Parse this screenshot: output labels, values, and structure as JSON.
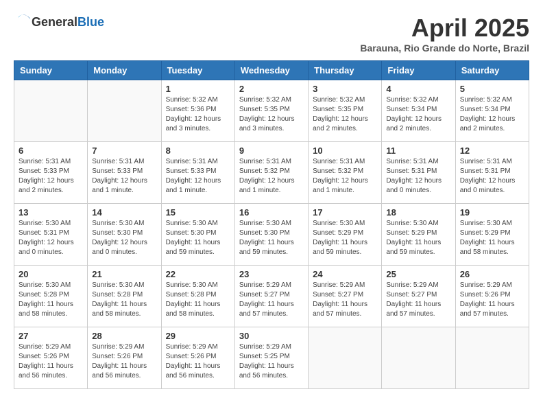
{
  "header": {
    "logo_general": "General",
    "logo_blue": "Blue",
    "month": "April 2025",
    "location": "Barauna, Rio Grande do Norte, Brazil"
  },
  "weekdays": [
    "Sunday",
    "Monday",
    "Tuesday",
    "Wednesday",
    "Thursday",
    "Friday",
    "Saturday"
  ],
  "weeks": [
    [
      {
        "day": "",
        "info": ""
      },
      {
        "day": "",
        "info": ""
      },
      {
        "day": "1",
        "info": "Sunrise: 5:32 AM\nSunset: 5:36 PM\nDaylight: 12 hours and 3 minutes."
      },
      {
        "day": "2",
        "info": "Sunrise: 5:32 AM\nSunset: 5:35 PM\nDaylight: 12 hours and 3 minutes."
      },
      {
        "day": "3",
        "info": "Sunrise: 5:32 AM\nSunset: 5:35 PM\nDaylight: 12 hours and 2 minutes."
      },
      {
        "day": "4",
        "info": "Sunrise: 5:32 AM\nSunset: 5:34 PM\nDaylight: 12 hours and 2 minutes."
      },
      {
        "day": "5",
        "info": "Sunrise: 5:32 AM\nSunset: 5:34 PM\nDaylight: 12 hours and 2 minutes."
      }
    ],
    [
      {
        "day": "6",
        "info": "Sunrise: 5:31 AM\nSunset: 5:33 PM\nDaylight: 12 hours and 2 minutes."
      },
      {
        "day": "7",
        "info": "Sunrise: 5:31 AM\nSunset: 5:33 PM\nDaylight: 12 hours and 1 minute."
      },
      {
        "day": "8",
        "info": "Sunrise: 5:31 AM\nSunset: 5:33 PM\nDaylight: 12 hours and 1 minute."
      },
      {
        "day": "9",
        "info": "Sunrise: 5:31 AM\nSunset: 5:32 PM\nDaylight: 12 hours and 1 minute."
      },
      {
        "day": "10",
        "info": "Sunrise: 5:31 AM\nSunset: 5:32 PM\nDaylight: 12 hours and 1 minute."
      },
      {
        "day": "11",
        "info": "Sunrise: 5:31 AM\nSunset: 5:31 PM\nDaylight: 12 hours and 0 minutes."
      },
      {
        "day": "12",
        "info": "Sunrise: 5:31 AM\nSunset: 5:31 PM\nDaylight: 12 hours and 0 minutes."
      }
    ],
    [
      {
        "day": "13",
        "info": "Sunrise: 5:30 AM\nSunset: 5:31 PM\nDaylight: 12 hours and 0 minutes."
      },
      {
        "day": "14",
        "info": "Sunrise: 5:30 AM\nSunset: 5:30 PM\nDaylight: 12 hours and 0 minutes."
      },
      {
        "day": "15",
        "info": "Sunrise: 5:30 AM\nSunset: 5:30 PM\nDaylight: 11 hours and 59 minutes."
      },
      {
        "day": "16",
        "info": "Sunrise: 5:30 AM\nSunset: 5:30 PM\nDaylight: 11 hours and 59 minutes."
      },
      {
        "day": "17",
        "info": "Sunrise: 5:30 AM\nSunset: 5:29 PM\nDaylight: 11 hours and 59 minutes."
      },
      {
        "day": "18",
        "info": "Sunrise: 5:30 AM\nSunset: 5:29 PM\nDaylight: 11 hours and 59 minutes."
      },
      {
        "day": "19",
        "info": "Sunrise: 5:30 AM\nSunset: 5:29 PM\nDaylight: 11 hours and 58 minutes."
      }
    ],
    [
      {
        "day": "20",
        "info": "Sunrise: 5:30 AM\nSunset: 5:28 PM\nDaylight: 11 hours and 58 minutes."
      },
      {
        "day": "21",
        "info": "Sunrise: 5:30 AM\nSunset: 5:28 PM\nDaylight: 11 hours and 58 minutes."
      },
      {
        "day": "22",
        "info": "Sunrise: 5:30 AM\nSunset: 5:28 PM\nDaylight: 11 hours and 58 minutes."
      },
      {
        "day": "23",
        "info": "Sunrise: 5:29 AM\nSunset: 5:27 PM\nDaylight: 11 hours and 57 minutes."
      },
      {
        "day": "24",
        "info": "Sunrise: 5:29 AM\nSunset: 5:27 PM\nDaylight: 11 hours and 57 minutes."
      },
      {
        "day": "25",
        "info": "Sunrise: 5:29 AM\nSunset: 5:27 PM\nDaylight: 11 hours and 57 minutes."
      },
      {
        "day": "26",
        "info": "Sunrise: 5:29 AM\nSunset: 5:26 PM\nDaylight: 11 hours and 57 minutes."
      }
    ],
    [
      {
        "day": "27",
        "info": "Sunrise: 5:29 AM\nSunset: 5:26 PM\nDaylight: 11 hours and 56 minutes."
      },
      {
        "day": "28",
        "info": "Sunrise: 5:29 AM\nSunset: 5:26 PM\nDaylight: 11 hours and 56 minutes."
      },
      {
        "day": "29",
        "info": "Sunrise: 5:29 AM\nSunset: 5:26 PM\nDaylight: 11 hours and 56 minutes."
      },
      {
        "day": "30",
        "info": "Sunrise: 5:29 AM\nSunset: 5:25 PM\nDaylight: 11 hours and 56 minutes."
      },
      {
        "day": "",
        "info": ""
      },
      {
        "day": "",
        "info": ""
      },
      {
        "day": "",
        "info": ""
      }
    ]
  ]
}
